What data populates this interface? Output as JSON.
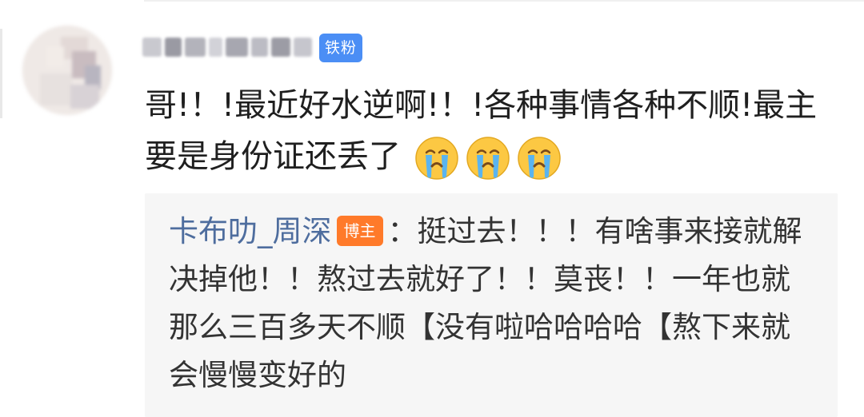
{
  "comment": {
    "badge": "铁粉",
    "text": "哥!！!最近好水逆啊!！!各种事情各种不顺!最主要是身份证还丢了",
    "emojis": [
      "crying-face",
      "crying-face",
      "crying-face"
    ]
  },
  "reply": {
    "author": "卡布叻_周深",
    "badge": "博主",
    "text": "：挺过去！！！有啥事来接就解决掉他！！熬过去就好了！！莫丧！！一年也就那么三百多天不顺【没有啦哈哈哈哈【熬下来就会慢慢变好的"
  },
  "colors": {
    "fan_badge": "#4b8ef5",
    "author_badge": "#ff7a2a",
    "author_name": "#4e6d9e",
    "reply_bg": "#f6f6f6"
  }
}
